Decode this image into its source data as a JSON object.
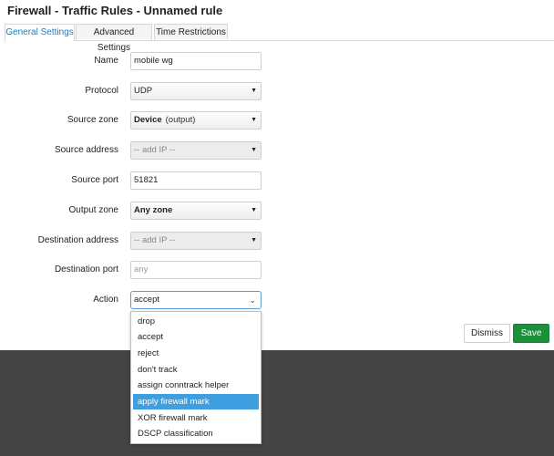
{
  "page": {
    "title": "Firewall - Traffic Rules - Unnamed rule"
  },
  "tabs": [
    {
      "label": "General Settings",
      "active": true
    },
    {
      "label": "Advanced Settings",
      "active": false
    },
    {
      "label": "Time Restrictions",
      "active": false
    }
  ],
  "form": {
    "name": {
      "label": "Name",
      "value": "mobile wg"
    },
    "protocol": {
      "label": "Protocol",
      "value": "UDP"
    },
    "source_zone": {
      "label": "Source zone",
      "value": "Device",
      "hint": "(output)"
    },
    "source_address": {
      "label": "Source address",
      "placeholder": "-- add IP --"
    },
    "source_port": {
      "label": "Source port",
      "value": "51821"
    },
    "output_zone": {
      "label": "Output zone",
      "value": "Any zone"
    },
    "destination_address": {
      "label": "Destination address",
      "placeholder": "-- add IP --"
    },
    "destination_port": {
      "label": "Destination port",
      "placeholder": "any"
    },
    "action": {
      "label": "Action",
      "value": "accept"
    }
  },
  "action_options": [
    "drop",
    "accept",
    "reject",
    "don't track",
    "assign conntrack helper",
    "apply firewall mark",
    "XOR firewall mark",
    "DSCP classification"
  ],
  "action_highlighted": "apply firewall mark",
  "buttons": {
    "dismiss": "Dismiss",
    "save": "Save"
  },
  "colors": {
    "accent": "#1a7cc1",
    "save": "#1b8f3a",
    "highlight": "#3d9fe0",
    "footer": "#444444"
  },
  "icons": {
    "select_arrow": "triangle-down-icon",
    "action_chevron": "chevron-down-icon"
  }
}
